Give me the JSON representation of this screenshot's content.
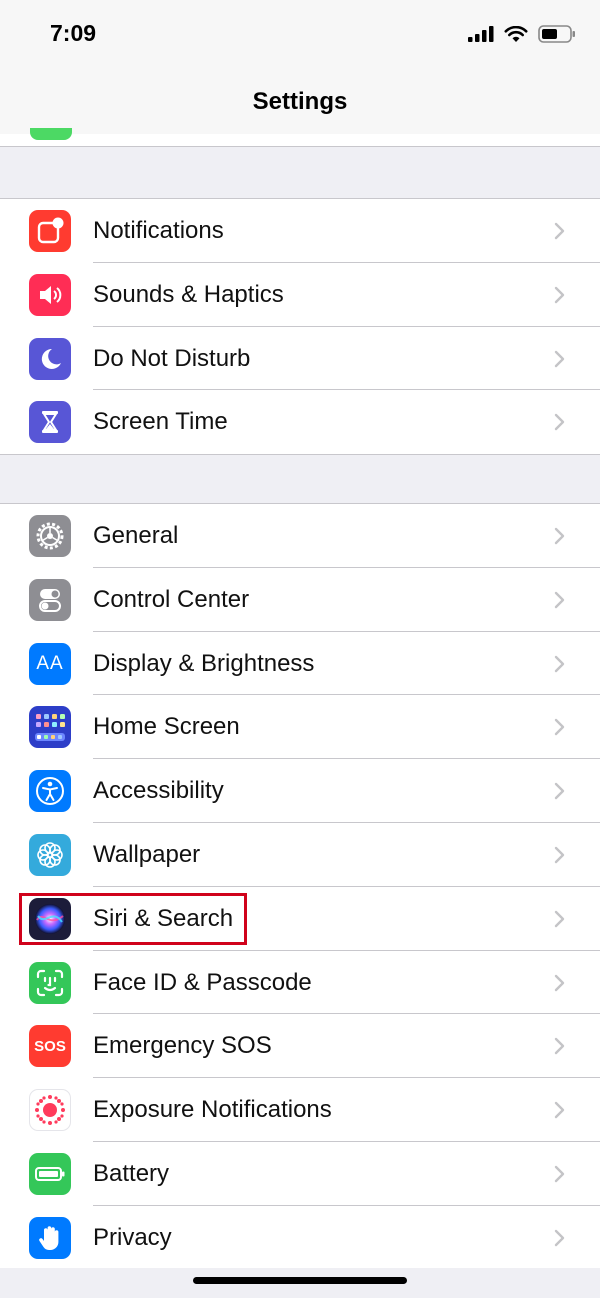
{
  "status_bar": {
    "time": "7:09"
  },
  "nav": {
    "title": "Settings"
  },
  "group1": [
    {
      "label": "Notifications",
      "icon": "notifications-icon",
      "color": "#ff3b30"
    },
    {
      "label": "Sounds & Haptics",
      "icon": "speaker-icon",
      "color": "#ff2d55"
    },
    {
      "label": "Do Not Disturb",
      "icon": "moon-icon",
      "color": "#5856d6"
    },
    {
      "label": "Screen Time",
      "icon": "hourglass-icon",
      "color": "#5856d6"
    }
  ],
  "group2": [
    {
      "label": "General",
      "icon": "gear-icon",
      "color": "#8e8e93"
    },
    {
      "label": "Control Center",
      "icon": "toggles-icon",
      "color": "#8e8e93"
    },
    {
      "label": "Display & Brightness",
      "icon": "text-size-icon",
      "color": "#007aff"
    },
    {
      "label": "Home Screen",
      "icon": "app-grid-icon",
      "color": "#2d3ec8"
    },
    {
      "label": "Accessibility",
      "icon": "accessibility-icon",
      "color": "#007aff"
    },
    {
      "label": "Wallpaper",
      "icon": "flower-icon",
      "color": "#34aadc"
    },
    {
      "label": "Siri & Search",
      "icon": "siri-icon",
      "color": "#1c1c3a"
    },
    {
      "label": "Face ID & Passcode",
      "icon": "face-id-icon",
      "color": "#34c759"
    },
    {
      "label": "Emergency SOS",
      "icon": "sos-icon",
      "color": "#ff3b30"
    },
    {
      "label": "Exposure Notifications",
      "icon": "exposure-icon",
      "color": "#ffffff"
    },
    {
      "label": "Battery",
      "icon": "battery-icon",
      "color": "#34c759"
    },
    {
      "label": "Privacy",
      "icon": "hand-icon",
      "color": "#007aff"
    }
  ],
  "sos_text": "SOS",
  "aa_text": "AA"
}
